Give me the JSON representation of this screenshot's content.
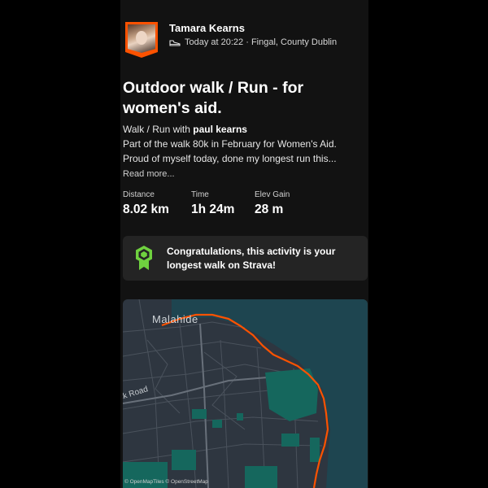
{
  "athlete": {
    "name": "Tamara Kearns",
    "meta": "Today at 20:22 · Fingal, County Dublin",
    "activity_icon": "shoe-icon"
  },
  "activity": {
    "title": "Outdoor walk / Run - for women's aid.",
    "with_prefix": "Walk / Run with ",
    "with_name": "paul kearns",
    "description": "Part of the walk 80k in February for Women's Aid. Proud of myself today, done my longest run this...",
    "read_more": "Read more..."
  },
  "stats": [
    {
      "label": "Distance",
      "value": "8.02 km"
    },
    {
      "label": "Time",
      "value": "1h 24m"
    },
    {
      "label": "Elev Gain",
      "value": "28 m"
    }
  ],
  "achievement": {
    "icon": "achievement-badge-icon",
    "text": "Congratulations, this activity is your longest walk on Strava!"
  },
  "map": {
    "place_label": "Malahide",
    "road_label": "ck Road",
    "attribution": "© OpenMapTiles © OpenStreetMap"
  },
  "colors": {
    "brand": "#fc5200",
    "badge_green": "#6fd13f",
    "background": "#121212",
    "card": "#242424"
  }
}
